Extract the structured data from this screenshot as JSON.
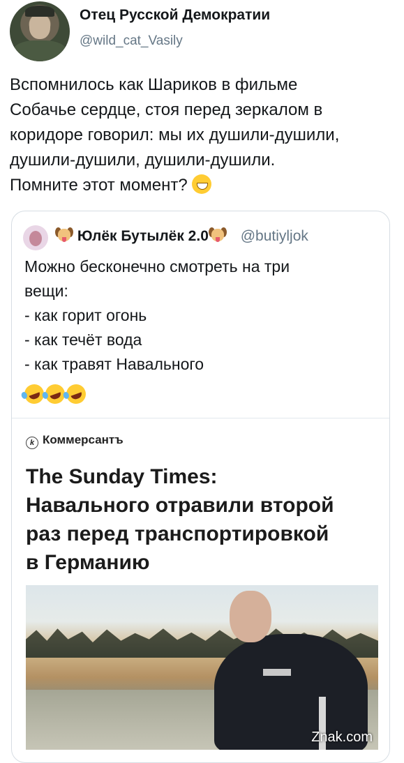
{
  "tweet": {
    "display_name": "Отец Русской Демократии",
    "handle": "@wild_cat_Vasily",
    "text": "Вспомнилось как Шариков в фильме\nСобачье сердце, стоя перед зеркалом в\nкоридоре говорил: мы их душили-душили,\nдушили-душили, душили-душили.\nПомните этот момент? ",
    "emoji": "grinning-face"
  },
  "quote": {
    "display_name": "Юлёк Бутылёк 2.0",
    "handle": "@butiyljok",
    "text": "Можно бесконечно смотреть на три\nвещи:\n- как горит огонь\n- как течёт вода\n- как травят Навального",
    "emojis": [
      "rolling-laughing-face",
      "rolling-laughing-face",
      "rolling-laughing-face"
    ],
    "card": {
      "source_icon": "k",
      "source": "Коммерсантъ",
      "headline": "The Sunday Times:\nНавального отравили второй\nраз перед транспортировкой\nв Германию",
      "watermark": "Znak.com"
    }
  },
  "colors": {
    "text": "#14171a",
    "secondary": "#657786",
    "border": "#d6dde3"
  }
}
